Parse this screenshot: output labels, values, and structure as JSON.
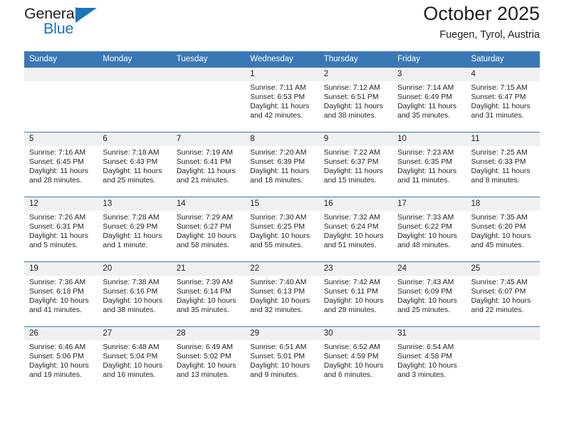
{
  "brand": {
    "name_top": "General",
    "name_bottom": "Blue",
    "accent_color": "#1b75bc"
  },
  "header": {
    "title": "October 2025",
    "subtitle": "Fuegen, Tyrol, Austria"
  },
  "theme": {
    "header_row_bg": "#3a78b5",
    "daynum_bg": "#f0f0f0",
    "page_bg": "#ffffff",
    "text_color": "#231f20"
  },
  "weekday_headers": [
    "Sunday",
    "Monday",
    "Tuesday",
    "Wednesday",
    "Thursday",
    "Friday",
    "Saturday"
  ],
  "weeks": [
    [
      {
        "empty": true
      },
      {
        "empty": true
      },
      {
        "empty": true
      },
      {
        "day": "1",
        "sunrise": "Sunrise: 7:11 AM",
        "sunset": "Sunset: 6:53 PM",
        "daylight": "Daylight: 11 hours and 42 minutes."
      },
      {
        "day": "2",
        "sunrise": "Sunrise: 7:12 AM",
        "sunset": "Sunset: 6:51 PM",
        "daylight": "Daylight: 11 hours and 38 minutes."
      },
      {
        "day": "3",
        "sunrise": "Sunrise: 7:14 AM",
        "sunset": "Sunset: 6:49 PM",
        "daylight": "Daylight: 11 hours and 35 minutes."
      },
      {
        "day": "4",
        "sunrise": "Sunrise: 7:15 AM",
        "sunset": "Sunset: 6:47 PM",
        "daylight": "Daylight: 11 hours and 31 minutes."
      }
    ],
    [
      {
        "day": "5",
        "sunrise": "Sunrise: 7:16 AM",
        "sunset": "Sunset: 6:45 PM",
        "daylight": "Daylight: 11 hours and 28 minutes."
      },
      {
        "day": "6",
        "sunrise": "Sunrise: 7:18 AM",
        "sunset": "Sunset: 6:43 PM",
        "daylight": "Daylight: 11 hours and 25 minutes."
      },
      {
        "day": "7",
        "sunrise": "Sunrise: 7:19 AM",
        "sunset": "Sunset: 6:41 PM",
        "daylight": "Daylight: 11 hours and 21 minutes."
      },
      {
        "day": "8",
        "sunrise": "Sunrise: 7:20 AM",
        "sunset": "Sunset: 6:39 PM",
        "daylight": "Daylight: 11 hours and 18 minutes."
      },
      {
        "day": "9",
        "sunrise": "Sunrise: 7:22 AM",
        "sunset": "Sunset: 6:37 PM",
        "daylight": "Daylight: 11 hours and 15 minutes."
      },
      {
        "day": "10",
        "sunrise": "Sunrise: 7:23 AM",
        "sunset": "Sunset: 6:35 PM",
        "daylight": "Daylight: 11 hours and 11 minutes."
      },
      {
        "day": "11",
        "sunrise": "Sunrise: 7:25 AM",
        "sunset": "Sunset: 6:33 PM",
        "daylight": "Daylight: 11 hours and 8 minutes."
      }
    ],
    [
      {
        "day": "12",
        "sunrise": "Sunrise: 7:26 AM",
        "sunset": "Sunset: 6:31 PM",
        "daylight": "Daylight: 11 hours and 5 minutes."
      },
      {
        "day": "13",
        "sunrise": "Sunrise: 7:28 AM",
        "sunset": "Sunset: 6:29 PM",
        "daylight": "Daylight: 11 hours and 1 minute."
      },
      {
        "day": "14",
        "sunrise": "Sunrise: 7:29 AM",
        "sunset": "Sunset: 6:27 PM",
        "daylight": "Daylight: 10 hours and 58 minutes."
      },
      {
        "day": "15",
        "sunrise": "Sunrise: 7:30 AM",
        "sunset": "Sunset: 6:25 PM",
        "daylight": "Daylight: 10 hours and 55 minutes."
      },
      {
        "day": "16",
        "sunrise": "Sunrise: 7:32 AM",
        "sunset": "Sunset: 6:24 PM",
        "daylight": "Daylight: 10 hours and 51 minutes."
      },
      {
        "day": "17",
        "sunrise": "Sunrise: 7:33 AM",
        "sunset": "Sunset: 6:22 PM",
        "daylight": "Daylight: 10 hours and 48 minutes."
      },
      {
        "day": "18",
        "sunrise": "Sunrise: 7:35 AM",
        "sunset": "Sunset: 6:20 PM",
        "daylight": "Daylight: 10 hours and 45 minutes."
      }
    ],
    [
      {
        "day": "19",
        "sunrise": "Sunrise: 7:36 AM",
        "sunset": "Sunset: 6:18 PM",
        "daylight": "Daylight: 10 hours and 41 minutes."
      },
      {
        "day": "20",
        "sunrise": "Sunrise: 7:38 AM",
        "sunset": "Sunset: 6:16 PM",
        "daylight": "Daylight: 10 hours and 38 minutes."
      },
      {
        "day": "21",
        "sunrise": "Sunrise: 7:39 AM",
        "sunset": "Sunset: 6:14 PM",
        "daylight": "Daylight: 10 hours and 35 minutes."
      },
      {
        "day": "22",
        "sunrise": "Sunrise: 7:40 AM",
        "sunset": "Sunset: 6:13 PM",
        "daylight": "Daylight: 10 hours and 32 minutes."
      },
      {
        "day": "23",
        "sunrise": "Sunrise: 7:42 AM",
        "sunset": "Sunset: 6:11 PM",
        "daylight": "Daylight: 10 hours and 28 minutes."
      },
      {
        "day": "24",
        "sunrise": "Sunrise: 7:43 AM",
        "sunset": "Sunset: 6:09 PM",
        "daylight": "Daylight: 10 hours and 25 minutes."
      },
      {
        "day": "25",
        "sunrise": "Sunrise: 7:45 AM",
        "sunset": "Sunset: 6:07 PM",
        "daylight": "Daylight: 10 hours and 22 minutes."
      }
    ],
    [
      {
        "day": "26",
        "sunrise": "Sunrise: 6:46 AM",
        "sunset": "Sunset: 5:06 PM",
        "daylight": "Daylight: 10 hours and 19 minutes."
      },
      {
        "day": "27",
        "sunrise": "Sunrise: 6:48 AM",
        "sunset": "Sunset: 5:04 PM",
        "daylight": "Daylight: 10 hours and 16 minutes."
      },
      {
        "day": "28",
        "sunrise": "Sunrise: 6:49 AM",
        "sunset": "Sunset: 5:02 PM",
        "daylight": "Daylight: 10 hours and 13 minutes."
      },
      {
        "day": "29",
        "sunrise": "Sunrise: 6:51 AM",
        "sunset": "Sunset: 5:01 PM",
        "daylight": "Daylight: 10 hours and 9 minutes."
      },
      {
        "day": "30",
        "sunrise": "Sunrise: 6:52 AM",
        "sunset": "Sunset: 4:59 PM",
        "daylight": "Daylight: 10 hours and 6 minutes."
      },
      {
        "day": "31",
        "sunrise": "Sunrise: 6:54 AM",
        "sunset": "Sunset: 4:58 PM",
        "daylight": "Daylight: 10 hours and 3 minutes."
      },
      {
        "empty": true
      }
    ]
  ]
}
